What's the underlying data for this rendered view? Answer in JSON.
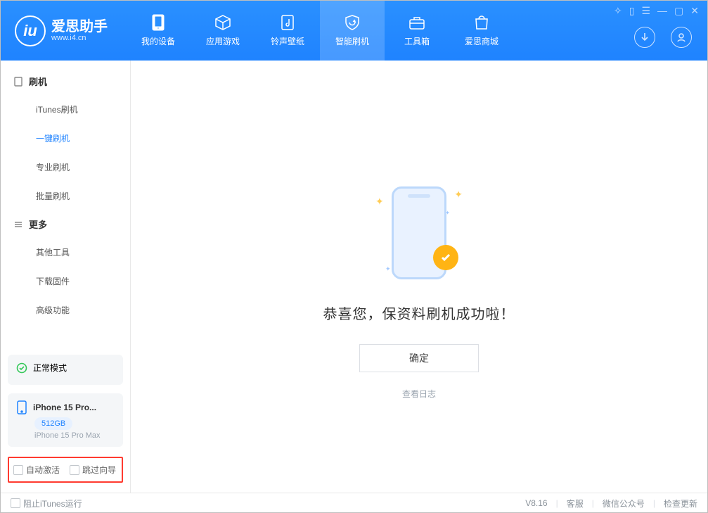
{
  "app": {
    "name": "爱思助手",
    "url": "www.i4.cn"
  },
  "nav": [
    {
      "label": "我的设备"
    },
    {
      "label": "应用游戏"
    },
    {
      "label": "铃声壁纸"
    },
    {
      "label": "智能刷机"
    },
    {
      "label": "工具箱"
    },
    {
      "label": "爱思商城"
    }
  ],
  "sidebar": {
    "group1": {
      "title": "刷机",
      "items": [
        "iTunes刷机",
        "一键刷机",
        "专业刷机",
        "批量刷机"
      ]
    },
    "group2": {
      "title": "更多",
      "items": [
        "其他工具",
        "下载固件",
        "高级功能"
      ]
    }
  },
  "device": {
    "mode": "正常模式",
    "name": "iPhone 15 Pro...",
    "capacity": "512GB",
    "model": "iPhone 15 Pro Max"
  },
  "options": {
    "auto_activate": "自动激活",
    "skip_guide": "跳过向导"
  },
  "main": {
    "headline": "恭喜您，保资料刷机成功啦！",
    "ok": "确定",
    "view_log": "查看日志"
  },
  "footer": {
    "block_itunes": "阻止iTunes运行",
    "version": "V8.16",
    "support": "客服",
    "wechat": "微信公众号",
    "check_update": "检查更新"
  }
}
